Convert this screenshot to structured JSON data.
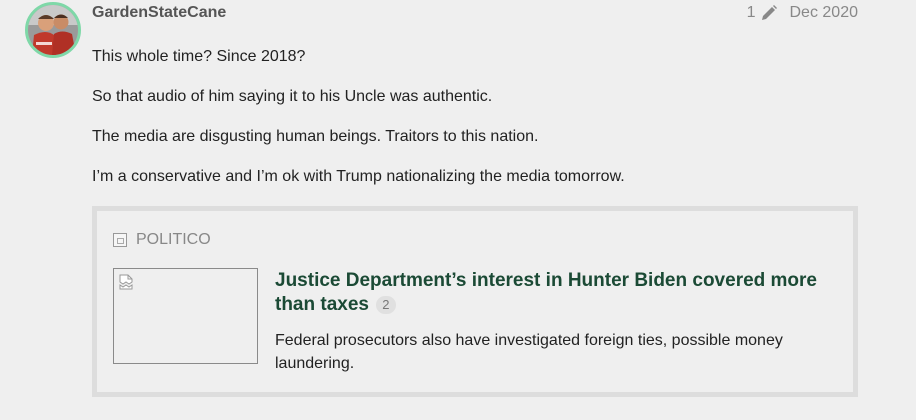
{
  "post": {
    "username": "GardenStateCane",
    "edit_count": "1",
    "date": "Dec 2020",
    "paragraphs": [
      "This whole time? Since 2018?",
      "So that audio of him saying it to his Uncle was authentic.",
      "The media are disgusting human beings. Traitors to this nation.",
      "I’m a conservative and I’m ok with Trump nationalizing the media tomorrow."
    ]
  },
  "onebox": {
    "source": "POLITICO",
    "title": "Justice Department’s interest in Hunter Biden covered more than taxes",
    "click_count": "2",
    "description": "Federal prosecutors also have investigated foreign ties, possible money laundering."
  },
  "icons": {
    "edit": "pencil-icon",
    "source": "favicon-icon",
    "thumbnail": "broken-image-icon"
  },
  "colors": {
    "avatar_ring": "#7fd8a8",
    "link_title": "#1b4a35",
    "muted": "#888888",
    "background": "#efefef",
    "card_border": "#dddddd"
  }
}
